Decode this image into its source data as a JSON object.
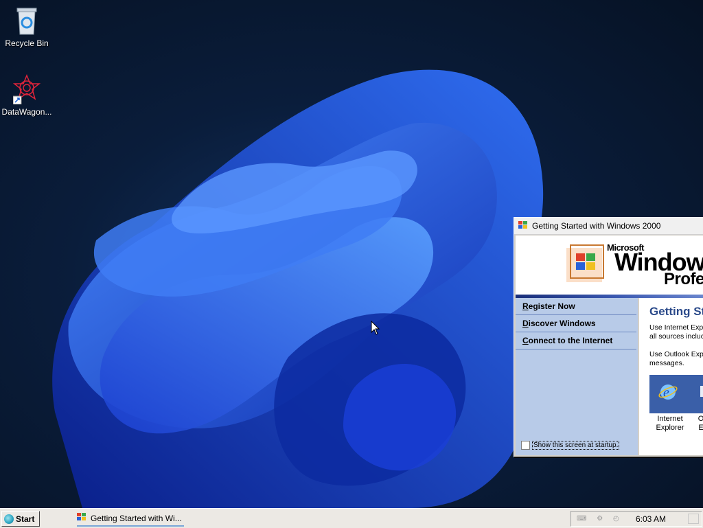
{
  "desktop": {
    "icons": [
      {
        "label": "Recycle Bin",
        "icon": "recycle-bin-icon"
      },
      {
        "label": "DataWagon...",
        "icon": "datawagon-shortcut-icon"
      }
    ]
  },
  "window": {
    "title": "Getting Started with Windows 2000",
    "banner": {
      "microsoft": "Microsoft",
      "windows": "Window",
      "edition": "Profe"
    },
    "links": [
      {
        "text": "Register Now",
        "access_key": "R",
        "rest": "egister Now"
      },
      {
        "text": "Discover Windows",
        "access_key": "D",
        "rest": "iscover Windows"
      },
      {
        "text": "Connect to the Internet",
        "access_key": "C",
        "rest": "onnect to the Internet"
      }
    ],
    "startup_checkbox": {
      "label": "Show this screen at startup.",
      "checked": false
    },
    "content": {
      "heading": "Getting St",
      "para1_line1": "Use Internet Exp",
      "para1_line2": "all sources incluc",
      "para2_line1": "Use Outlook Exp",
      "para2_line2": "messages.",
      "app1": {
        "line1": "Internet",
        "line2": "Explorer",
        "icon": "internet-explorer-icon"
      },
      "app2": {
        "line1": "O",
        "line2": "E",
        "icon": "outlook-express-icon"
      }
    }
  },
  "taskbar": {
    "start_label": "Start",
    "task_item": "Getting Started with Wi...",
    "tray_icons": "⌨ ⚙ ◴ ♪",
    "clock": "6:03 AM"
  },
  "colors": {
    "left_panel": "#b8cbe8",
    "heading": "#2b4a8a",
    "taskbar": "#ece9e4",
    "wallpaper_blue": "#1e4fe0"
  }
}
